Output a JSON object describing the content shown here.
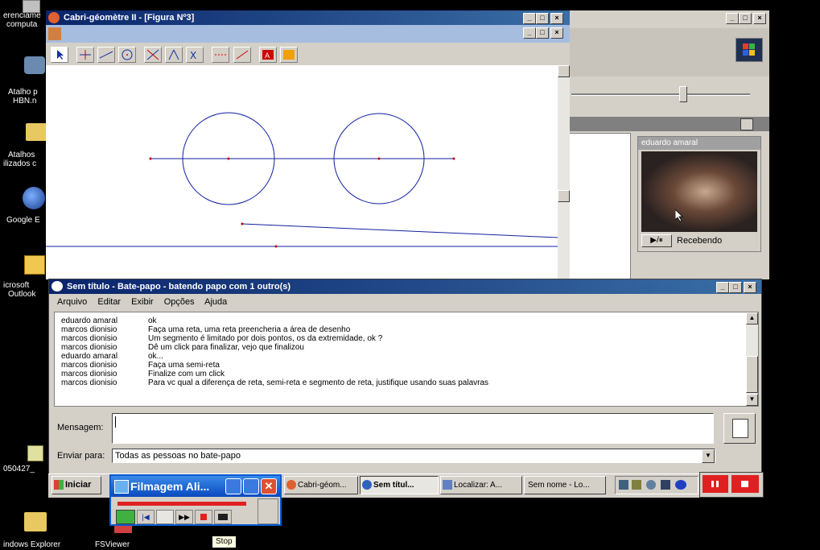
{
  "desktop": {
    "icons": [
      {
        "label": "Gerenciamento do computador",
        "line1": "erenciame",
        "line2": "computa"
      },
      {
        "label": "Atalho para HBN.n",
        "line1": "Atalho p",
        "line2": "HBN.n"
      },
      {
        "label": "Atalhos utilizados",
        "line1": "Atalhos",
        "line2": "ilizados c"
      },
      {
        "label": "Google Earth",
        "line1": "Google E",
        "line2": ""
      },
      {
        "label": "Microsoft Outlook",
        "line1": "icrosoft",
        "line2": "Outlook"
      },
      {
        "label": "050427_",
        "line1": "050427_",
        "line2": ""
      },
      {
        "label": "Windows Explorer",
        "line1": "indows Explorer",
        "line2": ""
      },
      {
        "label": "FSViewer",
        "line1": "FSViewer",
        "line2": ""
      }
    ]
  },
  "cabri": {
    "title": "Cabri-géomètre II - [Figura Nº3]"
  },
  "video": {
    "user": "eduardo amaral",
    "status": "Recebendo",
    "play_label": "▶/⏸"
  },
  "chat": {
    "title": "Sem título - Bate-papo - batendo papo com 1 outro(s)",
    "menu": [
      "Arquivo",
      "Editar",
      "Exibir",
      "Opções",
      "Ajuda"
    ],
    "messages": [
      {
        "name": "eduardo amaral",
        "text": "ok"
      },
      {
        "name": "marcos dionisio",
        "text": "Faça uma reta, uma reta preencheria a área de desenho"
      },
      {
        "name": "marcos dionisio",
        "text": "Um segmento é limitado por  dois pontos, os da extremidade, ok ?"
      },
      {
        "name": "marcos dionisio",
        "text": "Dê um click para finalizar, vejo que finalizou"
      },
      {
        "name": "eduardo amaral",
        "text": "ok..."
      },
      {
        "name": "marcos dionisio",
        "text": "Faça uma semi-reta"
      },
      {
        "name": "marcos dionisio",
        "text": "Finalize com um click"
      },
      {
        "name": "marcos dionisio",
        "text": "Para vc qual a diferença de reta, semi-reta e segmento de reta, justifique usando suas palavras"
      }
    ],
    "message_label": "Mensagem:",
    "send_to_label": "Enviar para:",
    "send_to_value": "Todas as pessoas no bate-papo"
  },
  "taskbar": {
    "start": "Iniciar",
    "items": [
      "Cabri-géom...",
      "Sem títul...",
      "Localizar: A...",
      "Sem nome - Lo..."
    ]
  },
  "recorder": {
    "title": "Filmagem Ali...",
    "tooltip": "Stop"
  }
}
